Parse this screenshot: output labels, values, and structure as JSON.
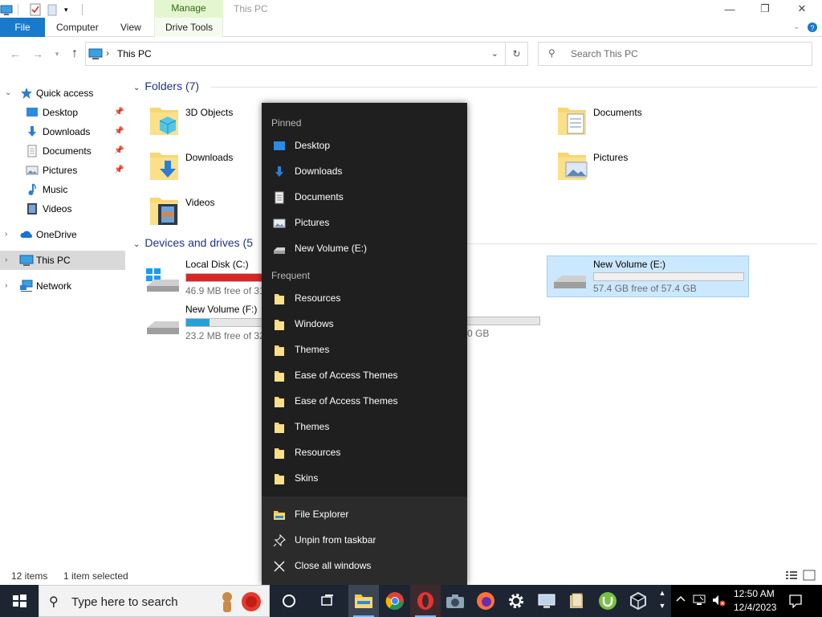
{
  "window": {
    "title": "This PC",
    "context_tab": "Manage"
  },
  "ribbon": {
    "tabs": [
      "File",
      "Computer",
      "View",
      "Drive Tools"
    ]
  },
  "address": {
    "path": "This PC",
    "search_placeholder": "Search This PC"
  },
  "nav": {
    "items": [
      {
        "label": "Quick access",
        "icon": "star-icon"
      },
      {
        "label": "Desktop",
        "icon": "desktop-icon",
        "pinned": true
      },
      {
        "label": "Downloads",
        "icon": "download-icon",
        "pinned": true
      },
      {
        "label": "Documents",
        "icon": "documents-icon",
        "pinned": true
      },
      {
        "label": "Pictures",
        "icon": "pictures-icon",
        "pinned": true
      },
      {
        "label": "Music",
        "icon": "music-icon"
      },
      {
        "label": "Videos",
        "icon": "videos-icon"
      },
      {
        "label": "OneDrive",
        "icon": "cloud-icon"
      },
      {
        "label": "This PC",
        "icon": "pc-icon",
        "selected": true
      },
      {
        "label": "Network",
        "icon": "network-icon"
      }
    ]
  },
  "content": {
    "folders_header": "Folders (7)",
    "folders": [
      {
        "name": "3D Objects"
      },
      {
        "name": "Documents"
      },
      {
        "name": "Downloads"
      },
      {
        "name": "Pictures"
      },
      {
        "name": "Videos"
      }
    ],
    "drives_header": "Devices and drives (5",
    "drives": [
      {
        "name": "Local Disk (C:)",
        "free": "46.9 MB free of 31",
        "used_fraction": 0.99,
        "bar_color": "#da2626"
      },
      {
        "name": "New Volume (F:)",
        "free": "23.2 MB free of 32",
        "used_fraction": 0.3,
        "bar_color": "#26a0da"
      },
      {
        "name": "New Volume (E:)",
        "free": "57.4 GB free of 57.4 GB",
        "used_fraction": 0.0,
        "bar_color": "#26a0da",
        "selected": true
      }
    ],
    "partial_drive_text": "0 GB"
  },
  "jumplist": {
    "pinned_header": "Pinned",
    "pinned": [
      "Desktop",
      "Downloads",
      "Documents",
      "Pictures",
      "New Volume (E:)"
    ],
    "frequent_header": "Frequent",
    "frequent": [
      "Resources",
      "Windows",
      "Themes",
      "Ease of Access Themes",
      "Ease of Access Themes",
      "Themes",
      "Resources",
      "Skins"
    ],
    "tasks": [
      "File Explorer",
      "Unpin from taskbar",
      "Close all windows"
    ]
  },
  "status": {
    "count": "12 items",
    "selection": "1 item selected"
  },
  "taskbar": {
    "search_placeholder": "Type here to search",
    "time": "12:50 AM",
    "date": "12/4/2023"
  }
}
